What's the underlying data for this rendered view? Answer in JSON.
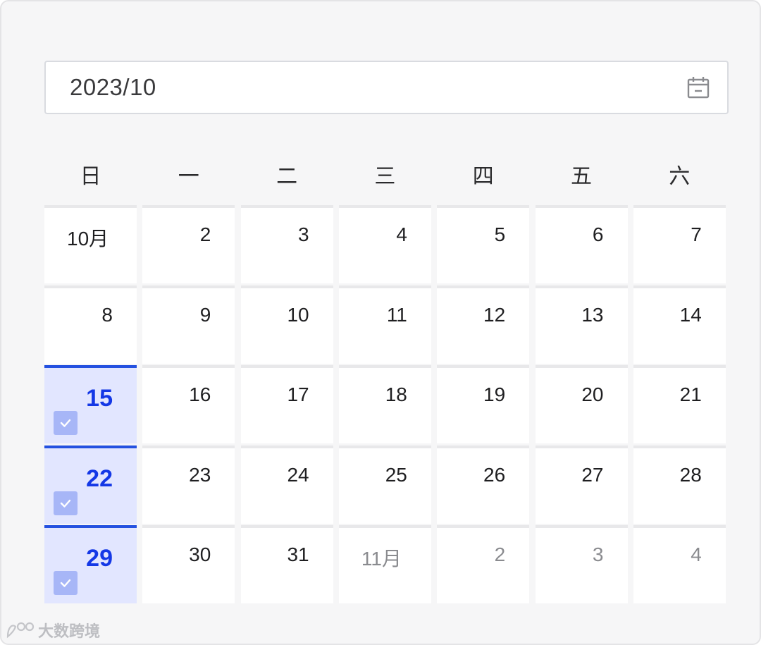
{
  "picker": {
    "value": "2023/10",
    "icon": "calendar-icon"
  },
  "weekdays": [
    "日",
    "一",
    "二",
    "三",
    "四",
    "五",
    "六"
  ],
  "weeks": [
    [
      {
        "label": "10月",
        "type": "month-label"
      },
      {
        "label": "2",
        "type": "current"
      },
      {
        "label": "3",
        "type": "current"
      },
      {
        "label": "4",
        "type": "current"
      },
      {
        "label": "5",
        "type": "current"
      },
      {
        "label": "6",
        "type": "current"
      },
      {
        "label": "7",
        "type": "current"
      }
    ],
    [
      {
        "label": "8",
        "type": "current"
      },
      {
        "label": "9",
        "type": "current"
      },
      {
        "label": "10",
        "type": "current"
      },
      {
        "label": "11",
        "type": "current"
      },
      {
        "label": "12",
        "type": "current"
      },
      {
        "label": "13",
        "type": "current"
      },
      {
        "label": "14",
        "type": "current"
      }
    ],
    [
      {
        "label": "15",
        "type": "current",
        "selected": true
      },
      {
        "label": "16",
        "type": "current"
      },
      {
        "label": "17",
        "type": "current"
      },
      {
        "label": "18",
        "type": "current"
      },
      {
        "label": "19",
        "type": "current"
      },
      {
        "label": "20",
        "type": "current"
      },
      {
        "label": "21",
        "type": "current"
      }
    ],
    [
      {
        "label": "22",
        "type": "current",
        "selected": true
      },
      {
        "label": "23",
        "type": "current"
      },
      {
        "label": "24",
        "type": "current"
      },
      {
        "label": "25",
        "type": "current"
      },
      {
        "label": "26",
        "type": "current"
      },
      {
        "label": "27",
        "type": "current"
      },
      {
        "label": "28",
        "type": "current"
      }
    ],
    [
      {
        "label": "29",
        "type": "current",
        "selected": true
      },
      {
        "label": "30",
        "type": "current"
      },
      {
        "label": "31",
        "type": "current"
      },
      {
        "label": "11月",
        "type": "month-label-other"
      },
      {
        "label": "2",
        "type": "other"
      },
      {
        "label": "3",
        "type": "other"
      },
      {
        "label": "4",
        "type": "other"
      }
    ]
  ],
  "colors": {
    "selected_bg": "#e2e6ff",
    "selected_accent": "#2451e0",
    "selected_text": "#1438e6",
    "check_bg": "#a7b6f7",
    "other_month_text": "#8a8b8f"
  },
  "watermark": {
    "text": "大数跨境",
    "icon": "logo-icon"
  }
}
